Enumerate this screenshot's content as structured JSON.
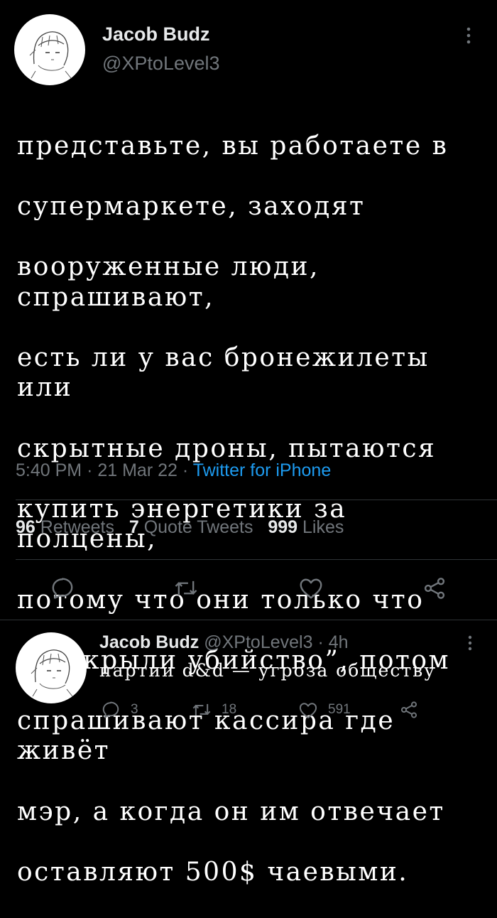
{
  "tweet": {
    "author_name": "Jacob Budz",
    "author_handle": "@XPtoLevel3",
    "text_lines": [
      "представьте, вы работаете в",
      "супермаркете, заходят",
      "вооруженные люди, спрашивают,",
      "есть ли у вас бронежилеты или",
      "скрытные дроны, пытаются",
      "купить энергетики за полцены,",
      "потому что они только что",
      "“раскрыли убийство”, потом",
      "спрашивают кассира где живёт",
      "мэр, а когда он им отвечает",
      "оставляют 500$ чаевыми."
    ],
    "time": "5:40 PM",
    "separator": "·",
    "date": "21 Mar 22",
    "source": "Twitter for iPhone",
    "retweets_count": "96",
    "retweets_label": "Retweets",
    "quotes_count": "7",
    "quotes_label": "Quote Tweets",
    "likes_count": "999",
    "likes_label": "Likes"
  },
  "reply": {
    "author_name": "Jacob Budz",
    "author_handle": "@XPtoLevel3",
    "separator": "·",
    "age": "4h",
    "text": "партии d&d — угроза обществу",
    "replies_count": "3",
    "retweets_count": "18",
    "likes_count": "591"
  },
  "icons": [
    "more-icon",
    "reply-icon",
    "retweet-icon",
    "like-icon",
    "share-icon"
  ],
  "colors": {
    "background": "#000000",
    "text": "#e7e9ea",
    "muted": "#71767b",
    "accent": "#1d9bf0",
    "divider": "#2f3336"
  }
}
